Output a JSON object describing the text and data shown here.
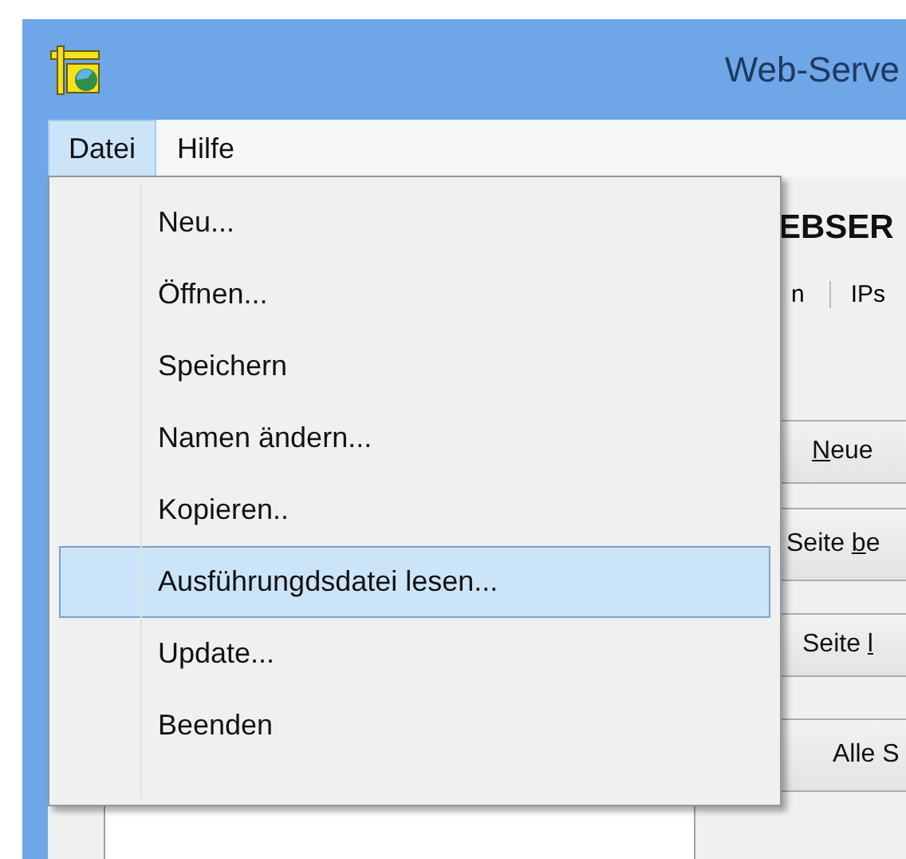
{
  "window": {
    "title": "Web-Serve"
  },
  "menubar": [
    {
      "label": "Datei",
      "selected": true
    },
    {
      "label": "Hilfe",
      "selected": false
    }
  ],
  "menu": {
    "items": [
      {
        "label": "Neu...",
        "selected": false
      },
      {
        "label": "Öffnen...",
        "selected": false
      },
      {
        "label": "Speichern",
        "selected": false
      },
      {
        "label": "Namen ändern...",
        "selected": false
      },
      {
        "label": "Kopieren..",
        "selected": false
      },
      {
        "label": "Ausführungdsdatei lesen...",
        "selected": true
      },
      {
        "label": "Update...",
        "selected": false
      },
      {
        "label": "Beenden",
        "selected": false
      }
    ]
  },
  "panel": {
    "heading": "EBSER",
    "tabs": [
      {
        "label": "n"
      },
      {
        "label": "IPs"
      }
    ],
    "buttons": [
      {
        "key": "N",
        "after": "eue"
      },
      {
        "before": "Seite ",
        "key": "b",
        "after": "e"
      },
      {
        "before": "Seite ",
        "key": "l"
      },
      {
        "before": "Alle S"
      }
    ]
  }
}
